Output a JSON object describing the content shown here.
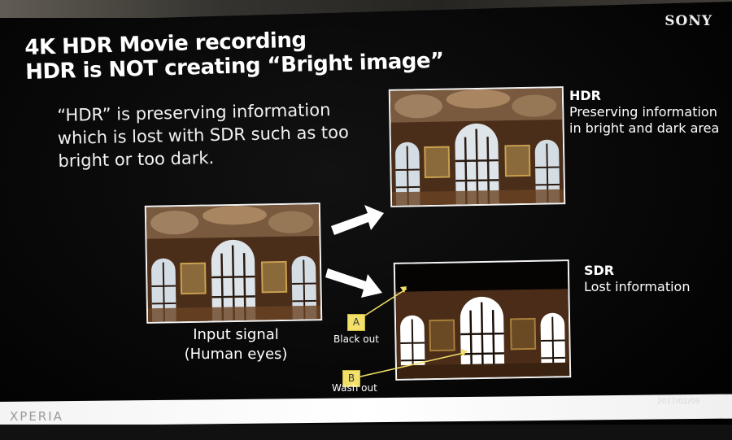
{
  "brand": "SONY",
  "title": {
    "line1": "4K HDR Movie recording",
    "line2": "HDR is NOT creating “Bright image”"
  },
  "description": "“HDR” is preserving information which is lost with SDR such as too bright or too dark.",
  "hdr": {
    "title": "HDR",
    "subtitle_line1": "Preserving information",
    "subtitle_line2": "in bright and dark area"
  },
  "sdr": {
    "title": "SDR",
    "subtitle": "Lost information"
  },
  "input": {
    "line1": "Input signal",
    "line2": "(Human eyes)"
  },
  "markers": {
    "a": "A",
    "a_label": "Black out",
    "b": "B",
    "b_label": "Wash out"
  },
  "footer": {
    "logo": "XPERIA",
    "date": "2017/02/09"
  },
  "colors": {
    "background": "#070707",
    "marker": "#f2e06a",
    "text": "#ffffff",
    "footer_bar": "#f4f4f4"
  }
}
